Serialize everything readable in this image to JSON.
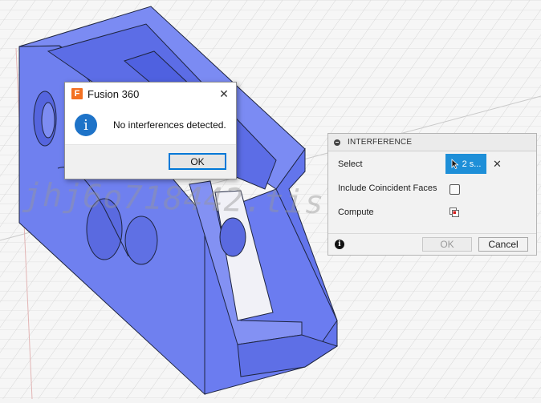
{
  "message_dialog": {
    "title": "Fusion 360",
    "logo_letter": "F",
    "message": "No interferences detected.",
    "ok_label": "OK",
    "close_glyph": "✕",
    "info_glyph": "i"
  },
  "interference_panel": {
    "title": "INTERFERENCE",
    "select_label": "Select",
    "select_value": "2 s...",
    "clear_glyph": "✕",
    "coincident_label": "Include Coincident Faces",
    "compute_label": "Compute",
    "ok_label": "OK",
    "cancel_label": "Cancel",
    "help_glyph": "i"
  },
  "watermark": "jhj6o718442.tistory.com",
  "colors": {
    "model_fill": "#6b7cf0",
    "selection_blue": "#1e8fd8",
    "info_blue": "#1e73c8",
    "logo_orange": "#f37021"
  }
}
